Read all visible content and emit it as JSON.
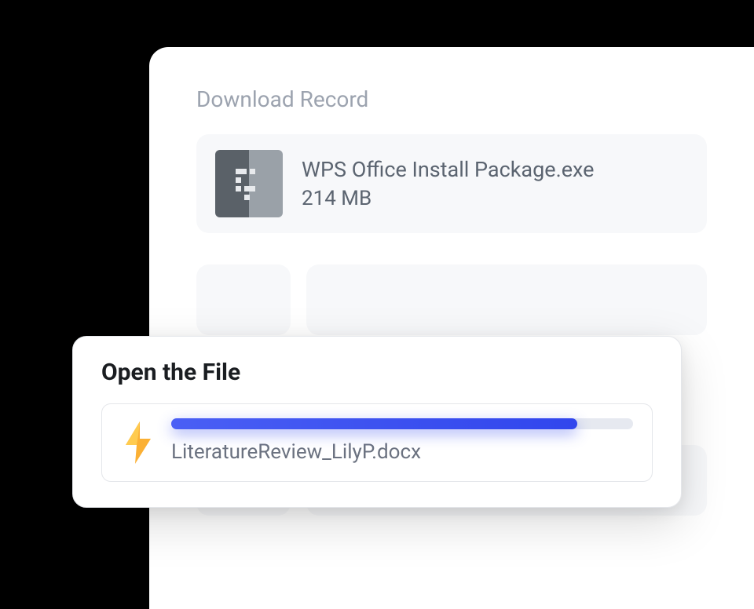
{
  "panel": {
    "title": "Download Record"
  },
  "download": {
    "filename": "WPS Office Install Package.exe",
    "size": "214 MB"
  },
  "openFile": {
    "title": "Open the File",
    "filename": "LiteratureReview_LilyP.docx",
    "progressPercent": 88
  }
}
